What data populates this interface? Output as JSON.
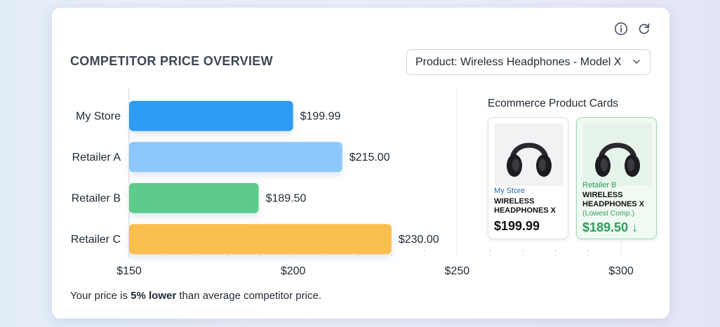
{
  "header": {
    "title": "COMPETITOR PRICE OVERVIEW",
    "product_select": "Product: Wireless Headphones - Model X",
    "icons": [
      "info-icon",
      "refresh-icon",
      "chevron-down-icon"
    ]
  },
  "chart_data": {
    "type": "bar",
    "orientation": "horizontal",
    "title": "COMPETITOR PRICE OVERVIEW",
    "categories": [
      "My Store",
      "Retailer A",
      "Retailer B",
      "Retailer C"
    ],
    "values": [
      199.99,
      215.0,
      189.5,
      230.0
    ],
    "value_labels": [
      "$199.99",
      "$215.00",
      "$189.50",
      "$230.00"
    ],
    "colors": [
      "#2f9bf5",
      "#8ec8fb",
      "#5fcb8a",
      "#fbbf50"
    ],
    "xlim": [
      150,
      300
    ],
    "x_ticks": [
      150,
      200,
      250,
      300
    ],
    "x_tick_labels": [
      "$150",
      "$200",
      "$250",
      "$300"
    ],
    "grid": "vertical dashed"
  },
  "summary": {
    "prefix": "Your price is ",
    "highlight": "5% lower",
    "suffix": " than average competitor price."
  },
  "product_cards": {
    "title": "Ecommerce Product Cards",
    "cards": [
      {
        "store": "My Store",
        "name_line1": "WIRELESS",
        "name_line2": "HEADPHONES X",
        "price": "$199.99",
        "store_color": "#2b6cb0",
        "price_color": "#111111"
      },
      {
        "store": "Retailer B",
        "name_line1": "WIRELESS",
        "name_line2": "HEADPHONES X",
        "note": "(Lowest Comp.)",
        "price": "$189.50 ↓",
        "store_color": "#2e9d5a",
        "price_color": "#2e9d5a"
      }
    ]
  }
}
